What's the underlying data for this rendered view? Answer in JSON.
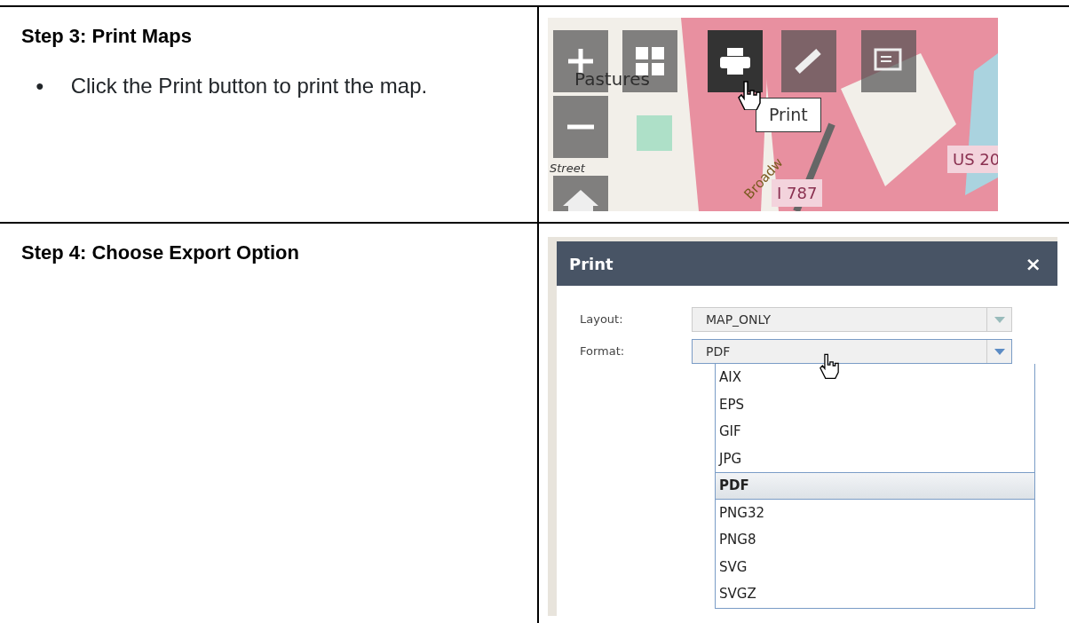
{
  "steps": [
    {
      "title": "Step 3: Print Maps",
      "bullets": [
        {
          "marker": "●",
          "text": "Click the Print button to print the map."
        }
      ],
      "map": {
        "labels": [
          {
            "kind": "area",
            "text": "Pastures"
          },
          {
            "kind": "street",
            "text": "Street"
          },
          {
            "kind": "road",
            "text": "Broadw"
          },
          {
            "kind": "shield",
            "text": "US 20"
          },
          {
            "kind": "shield",
            "text": "I 787"
          }
        ],
        "tools": [
          {
            "kind": "zoom-in",
            "active": false
          },
          {
            "kind": "grid",
            "active": false
          },
          {
            "kind": "print",
            "active": true
          },
          {
            "kind": "ruler",
            "active": false
          },
          {
            "kind": "edit",
            "active": false
          },
          {
            "kind": "zoom-out",
            "active": false
          },
          {
            "kind": "home",
            "active": false
          }
        ],
        "tooltip": "Print"
      }
    },
    {
      "title": "Step 4: Choose Export Option",
      "dialog": {
        "title": "Print",
        "close": "×",
        "fields": [
          {
            "label": "Layout:",
            "value": "MAP_ONLY",
            "open": false
          },
          {
            "label": "Format:",
            "value": "PDF",
            "open": true
          }
        ],
        "options": [
          {
            "label": "AIX",
            "selected": false
          },
          {
            "label": "EPS",
            "selected": false
          },
          {
            "label": "GIF",
            "selected": false
          },
          {
            "label": "JPG",
            "selected": false
          },
          {
            "label": "PDF",
            "selected": true
          },
          {
            "label": "PNG32",
            "selected": false
          },
          {
            "label": "PNG8",
            "selected": false
          },
          {
            "label": "SVG",
            "selected": false
          },
          {
            "label": "SVGZ",
            "selected": false
          }
        ]
      }
    }
  ]
}
